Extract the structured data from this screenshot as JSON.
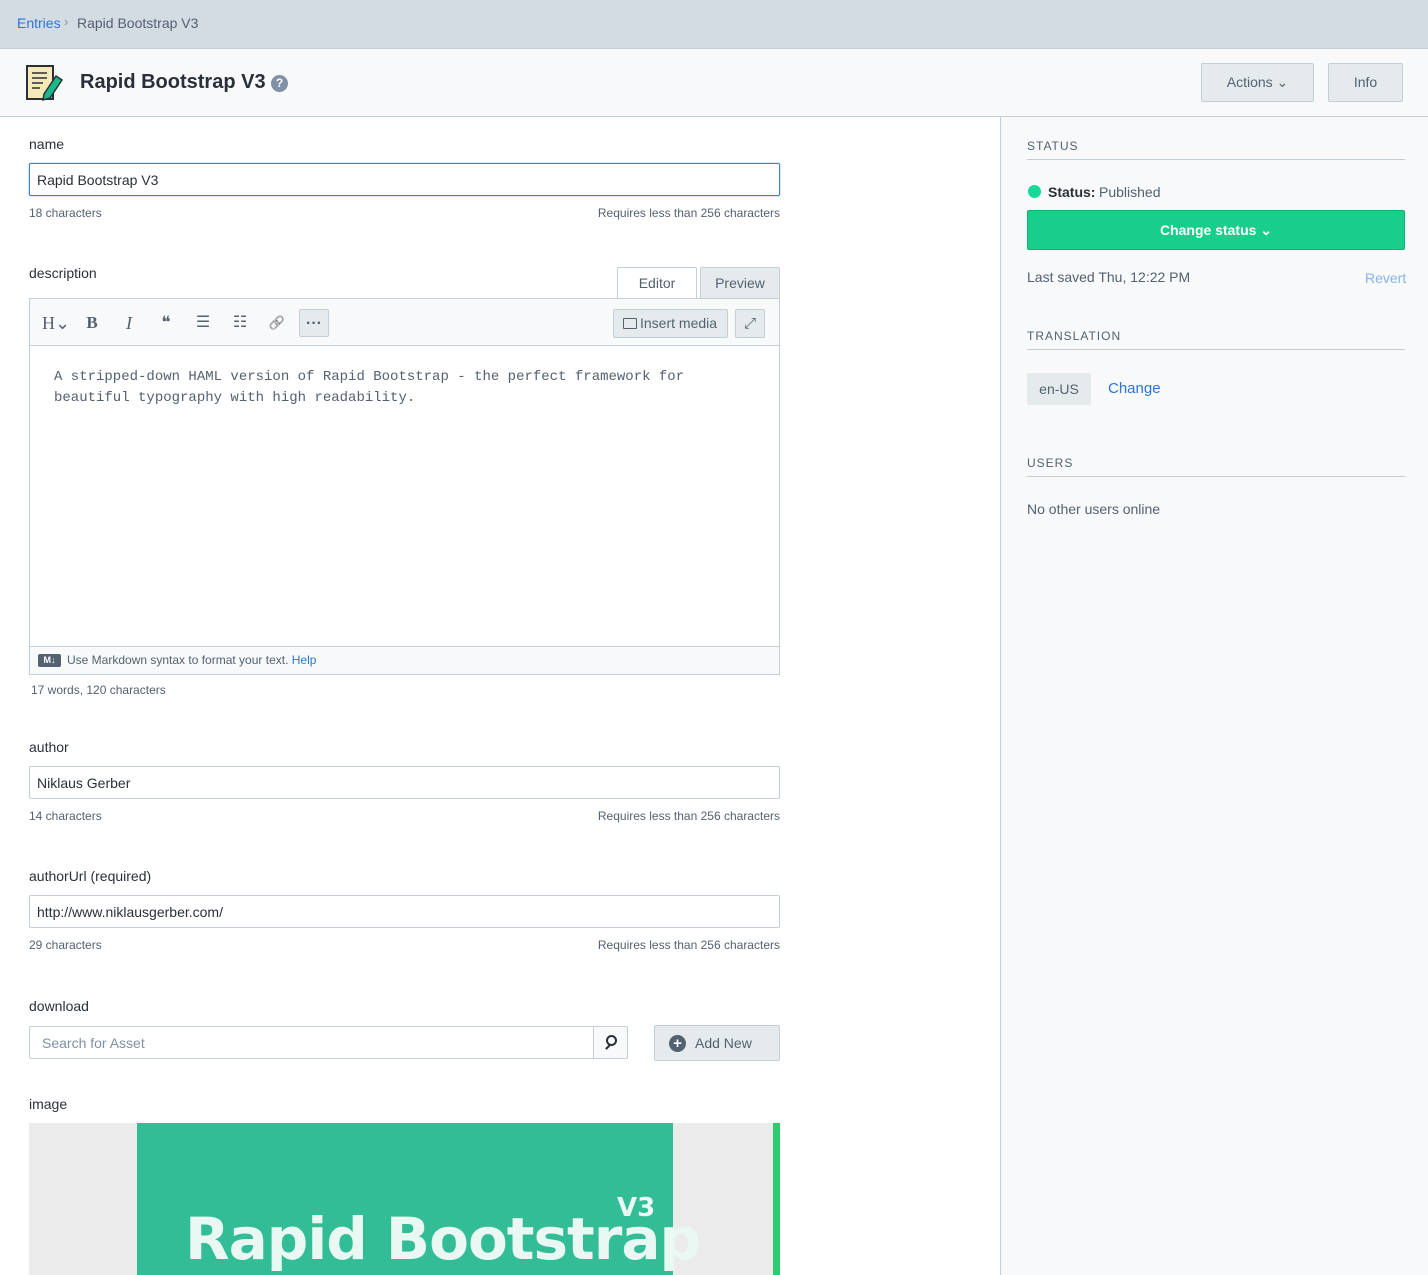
{
  "breadcrumb": {
    "root": "Entries",
    "separator": "›",
    "current": "Rapid Bootstrap V3"
  },
  "header": {
    "title": "Rapid Bootstrap V3",
    "help": "?",
    "actions_label": "Actions ⌄",
    "info_label": "Info"
  },
  "fields": {
    "name": {
      "label": "name",
      "value": "Rapid Bootstrap V3",
      "count": "18 characters",
      "limit": "Requires less than 256 characters"
    },
    "description": {
      "label": "description",
      "tab_editor": "Editor",
      "tab_preview": "Preview",
      "toolbar": {
        "heading": "H⌄",
        "bold": "B",
        "italic": "I",
        "quote": "❝",
        "bullet_list": "☰",
        "numbered_list": "☷",
        "link": "🔗",
        "more": "···",
        "insert_media": "Insert media",
        "fullscreen": "⤢"
      },
      "content": "A stripped-down HAML version of Rapid Bootstrap - the perfect framework for beautiful typography with high readability.",
      "footer_badge": "M↓",
      "footer_text": "Use Markdown syntax to format your text. ",
      "footer_help": "Help",
      "count": "17 words, 120 characters"
    },
    "author": {
      "label": "author",
      "value": "Niklaus Gerber",
      "count": "14 characters",
      "limit": "Requires less than 256 characters"
    },
    "authorUrl": {
      "label": "authorUrl (required)",
      "value": "http://www.niklausgerber.com/",
      "count": "29 characters",
      "limit": "Requires less than 256 characters"
    },
    "download": {
      "label": "download",
      "placeholder": "Search for Asset",
      "add_new": "Add New",
      "add_icon": "+"
    },
    "image": {
      "label": "image",
      "preview_title": "Rapid Bootstrap",
      "preview_version": "V3"
    }
  },
  "sidebar": {
    "status_title": "STATUS",
    "status_label": "Status:",
    "status_value": "Published",
    "change_status": "Change status ⌄",
    "last_saved": "Last saved Thu, 12:22 PM",
    "revert": "Revert",
    "translation_title": "TRANSLATION",
    "locale": "en-US",
    "change_locale": "Change",
    "users_title": "USERS",
    "users_info": "No other users online"
  },
  "colors": {
    "accent_blue": "#2e75d4",
    "published_green": "#14d997",
    "primary_button": "#19cd8a"
  }
}
